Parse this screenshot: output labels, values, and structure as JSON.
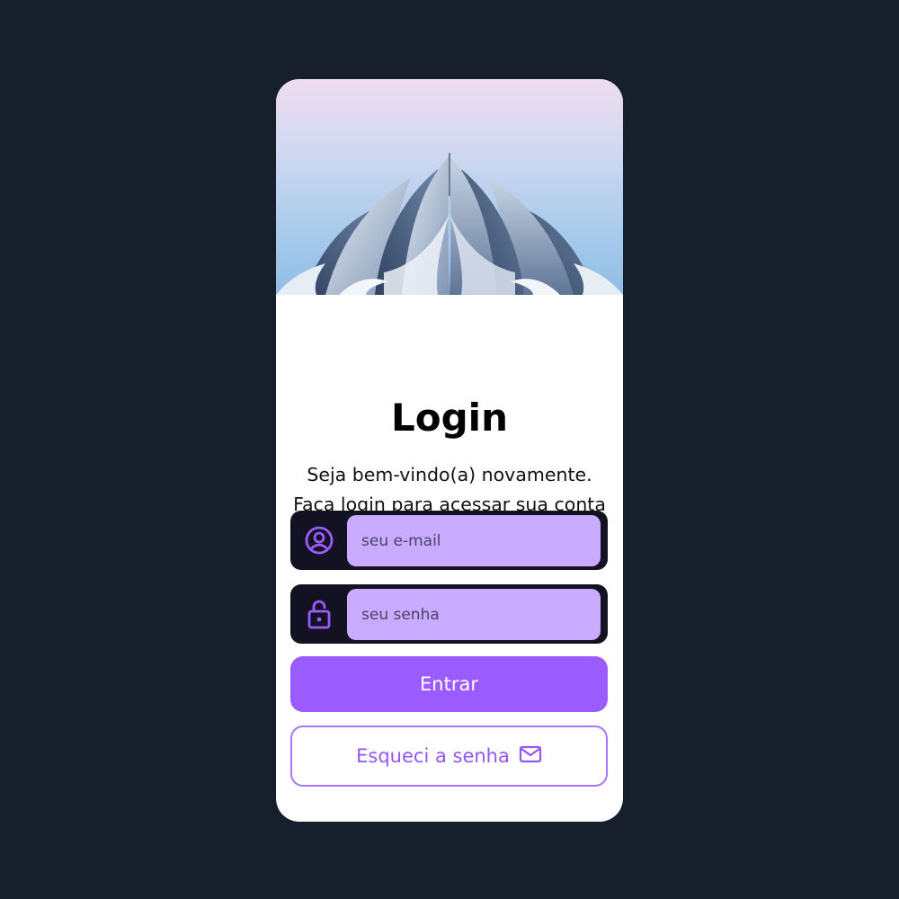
{
  "login": {
    "title": "Login",
    "subtitle": "Seja bem-vindo(a) novamente. Faça login para acessar sua conta e poder fazer as configurações no seu ambiente.",
    "email_placeholder": "seu e-mail",
    "email_value": "",
    "password_placeholder": "seu senha",
    "password_value": "",
    "submit_label": "Entrar",
    "forgot_label": "Esqueci a senha",
    "icons": {
      "email": "user-circle-icon",
      "password": "lock-icon",
      "forgot": "mail-icon"
    }
  },
  "colors": {
    "background": "#171f2c",
    "card": "#ffffff",
    "accent": "#9a5bff",
    "input_fill": "#c9acff",
    "field_frame": "#121222",
    "outline_button": "#a676ff"
  }
}
